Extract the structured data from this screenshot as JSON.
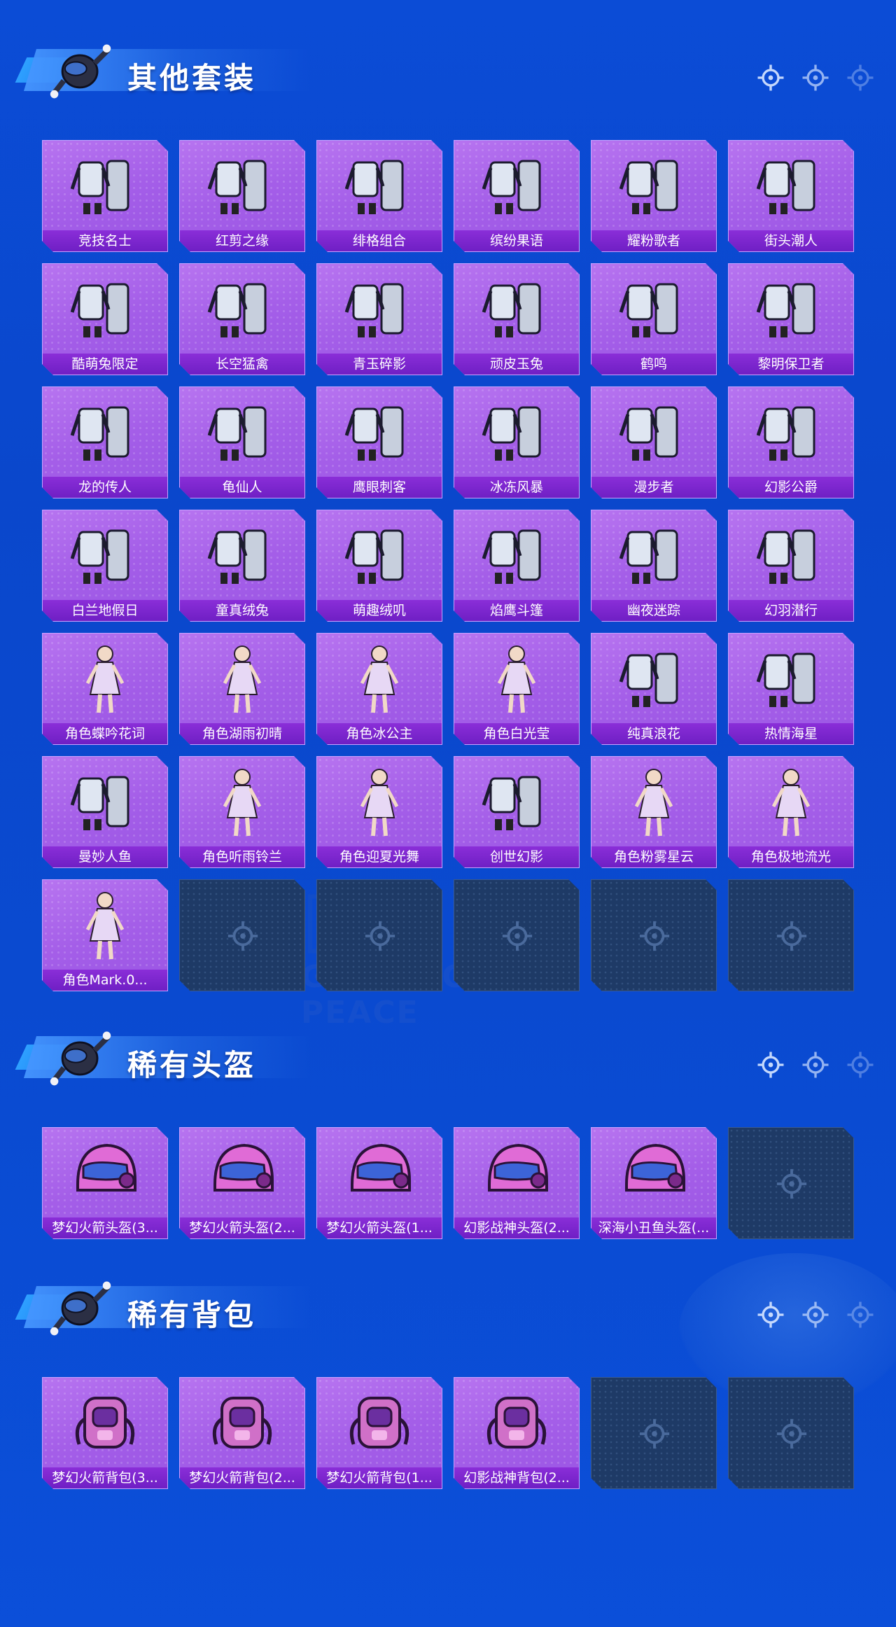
{
  "colors": {
    "background": "#0b4cd6",
    "card_purple": "#a45ee8",
    "label_purple": "#7a25cc",
    "empty_card": "#1e3a66"
  },
  "watermark": "GAME FOR PEACE",
  "sections": {
    "outfits": {
      "title": "其他套装",
      "items": [
        {
          "label": "竞技名士",
          "icon": "outfit-icon"
        },
        {
          "label": "红剪之缘",
          "icon": "outfit-icon"
        },
        {
          "label": "绯格组合",
          "icon": "outfit-icon"
        },
        {
          "label": "缤纷果语",
          "icon": "outfit-icon"
        },
        {
          "label": "耀粉歌者",
          "icon": "outfit-icon"
        },
        {
          "label": "街头潮人",
          "icon": "outfit-icon"
        },
        {
          "label": "酷萌兔限定",
          "icon": "outfit-icon"
        },
        {
          "label": "长空猛禽",
          "icon": "outfit-icon"
        },
        {
          "label": "青玉碎影",
          "icon": "outfit-icon"
        },
        {
          "label": "顽皮玉兔",
          "icon": "outfit-icon"
        },
        {
          "label": "鹤鸣",
          "icon": "outfit-icon"
        },
        {
          "label": "黎明保卫者",
          "icon": "outfit-icon"
        },
        {
          "label": "龙的传人",
          "icon": "outfit-icon"
        },
        {
          "label": "龟仙人",
          "icon": "outfit-icon"
        },
        {
          "label": "鹰眼刺客",
          "icon": "outfit-icon"
        },
        {
          "label": "冰冻风暴",
          "icon": "outfit-icon"
        },
        {
          "label": "漫步者",
          "icon": "outfit-icon"
        },
        {
          "label": "幻影公爵",
          "icon": "outfit-icon"
        },
        {
          "label": "白兰地假日",
          "icon": "outfit-icon"
        },
        {
          "label": "童真绒兔",
          "icon": "outfit-icon"
        },
        {
          "label": "萌趣绒叽",
          "icon": "outfit-icon"
        },
        {
          "label": "焰鹰斗篷",
          "icon": "outfit-icon"
        },
        {
          "label": "幽夜迷踪",
          "icon": "outfit-icon"
        },
        {
          "label": "幻羽潜行",
          "icon": "outfit-icon"
        },
        {
          "label": "角色蝶吟花词",
          "icon": "character-icon"
        },
        {
          "label": "角色湖雨初晴",
          "icon": "character-icon"
        },
        {
          "label": "角色冰公主",
          "icon": "character-icon"
        },
        {
          "label": "角色白光莹",
          "icon": "character-icon"
        },
        {
          "label": "纯真浪花",
          "icon": "outfit-icon"
        },
        {
          "label": "热情海星",
          "icon": "outfit-icon"
        },
        {
          "label": "曼妙人鱼",
          "icon": "outfit-icon"
        },
        {
          "label": "角色听雨铃兰",
          "icon": "character-icon"
        },
        {
          "label": "角色迎夏光舞",
          "icon": "character-icon"
        },
        {
          "label": "创世幻影",
          "icon": "outfit-icon"
        },
        {
          "label": "角色粉雾星云",
          "icon": "character-icon"
        },
        {
          "label": "角色极地流光",
          "icon": "character-icon"
        },
        {
          "label": "角色Mark.0...",
          "icon": "character-icon"
        }
      ],
      "empty_slots": 5
    },
    "helmets": {
      "title": "稀有头盔",
      "items": [
        {
          "label": "梦幻火箭头盔(3...",
          "icon": "helmet-icon"
        },
        {
          "label": "梦幻火箭头盔(2...",
          "icon": "helmet-icon"
        },
        {
          "label": "梦幻火箭头盔(1...",
          "icon": "helmet-icon"
        },
        {
          "label": "幻影战神头盔(2...",
          "icon": "helmet-icon"
        },
        {
          "label": "深海小丑鱼头盔(...",
          "icon": "helmet-icon"
        }
      ],
      "empty_slots": 1
    },
    "backpacks": {
      "title": "稀有背包",
      "items": [
        {
          "label": "梦幻火箭背包(3...",
          "icon": "backpack-icon"
        },
        {
          "label": "梦幻火箭背包(2...",
          "icon": "backpack-icon"
        },
        {
          "label": "梦幻火箭背包(1...",
          "icon": "backpack-icon"
        },
        {
          "label": "幻影战神背包(2...",
          "icon": "backpack-icon"
        }
      ],
      "empty_slots": 2
    }
  }
}
